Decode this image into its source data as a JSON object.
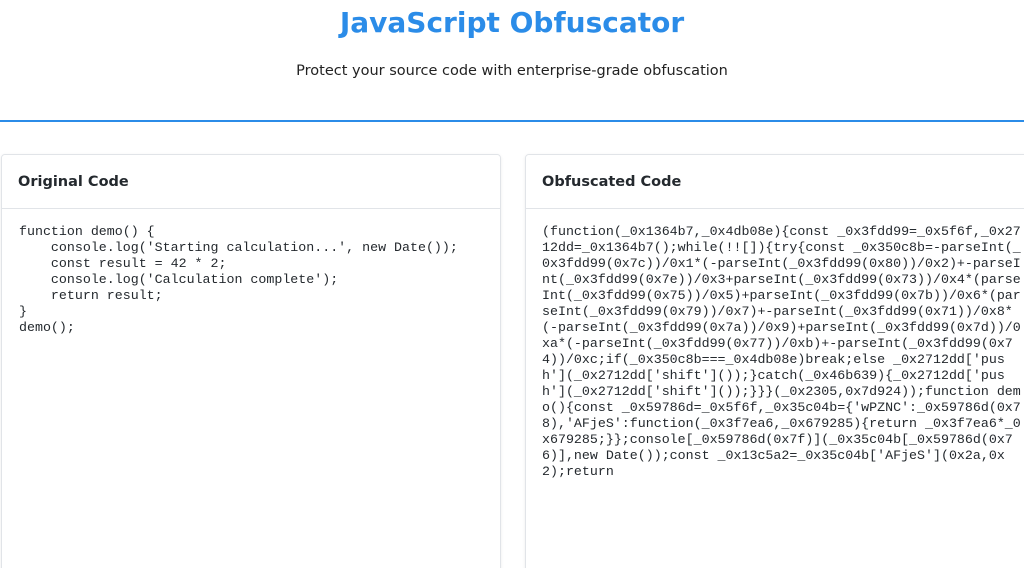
{
  "header": {
    "title": "JavaScript Obfuscator",
    "subtitle": "Protect your source code with enterprise-grade obfuscation"
  },
  "colors": {
    "accent": "#2b8ce8",
    "text": "#24292e",
    "border": "#e1e4e8"
  },
  "original": {
    "title": "Original Code",
    "code": "function demo() {\n    console.log('Starting calculation...', new Date());\n    const result = 42 * 2;\n    console.log('Calculation complete');\n    return result;\n}\ndemo();"
  },
  "obfuscated": {
    "title": "Obfuscated Code",
    "code": "(function(_0x1364b7,_0x4db08e){const _0x3fdd99=_0x5f6f,_0x2712dd=_0x1364b7();while(!![]){try{const _0x350c8b=-parseInt(_0x3fdd99(0x7c))/0x1*(-parseInt(_0x3fdd99(0x80))/0x2)+-parseInt(_0x3fdd99(0x7e))/0x3+parseInt(_0x3fdd99(0x73))/0x4*(parseInt(_0x3fdd99(0x75))/0x5)+parseInt(_0x3fdd99(0x7b))/0x6*(parseInt(_0x3fdd99(0x79))/0x7)+-parseInt(_0x3fdd99(0x71))/0x8*(-parseInt(_0x3fdd99(0x7a))/0x9)+parseInt(_0x3fdd99(0x7d))/0xa*(-parseInt(_0x3fdd99(0x77))/0xb)+-parseInt(_0x3fdd99(0x74))/0xc;if(_0x350c8b===_0x4db08e)break;else _0x2712dd['push'](_0x2712dd['shift']());}catch(_0x46b639){_0x2712dd['push'](_0x2712dd['shift']());}}}(_0x2305,0x7d924));function demo(){const _0x59786d=_0x5f6f,_0x35c04b={'wPZNC':_0x59786d(0x78),'AFjeS':function(_0x3f7ea6,_0x679285){return _0x3f7ea6*_0x679285;}};console[_0x59786d(0x7f)](_0x35c04b[_0x59786d(0x76)],new Date());const _0x13c5a2=_0x35c04b['AFjeS'](0x2a,0x2);return"
  }
}
